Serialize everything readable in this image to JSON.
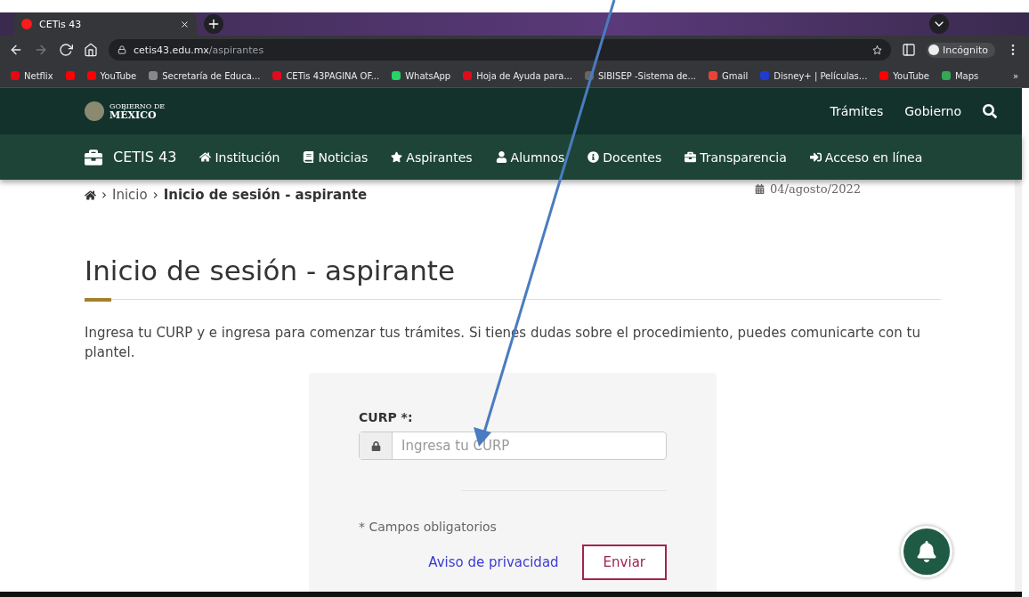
{
  "browser": {
    "tab": {
      "title": "CETis 43"
    },
    "url": {
      "host": "cetis43.edu.mx",
      "path": "/aspirantes"
    },
    "profile": "Incógnito",
    "bookmarks": [
      {
        "label": "Netflix",
        "color": "#e50914"
      },
      {
        "color": "#ff0000"
      },
      {
        "label": "YouTube",
        "color": "#ff0000"
      },
      {
        "label": "Secretaría de Educa...",
        "color": "#888888"
      },
      {
        "label": "CETis 43PAGINA OF...",
        "color": "#e00b1c"
      },
      {
        "label": "WhatsApp",
        "color": "#25d366"
      },
      {
        "label": "Hoja de Ayuda para...",
        "color": "#e00b1c"
      },
      {
        "label": "SIBISEP -Sistema de...",
        "color": "#666666"
      },
      {
        "label": "Gmail",
        "color": "#ea4335"
      },
      {
        "label": "Disney+ | Películas...",
        "color": "#1f3bd1"
      },
      {
        "label": "YouTube",
        "color": "#ff0000"
      },
      {
        "label": "Maps",
        "color": "#34a853"
      }
    ],
    "more": "»"
  },
  "gov_header": {
    "logo": "GOBIERNO DE",
    "logo_big": "MÉXICO",
    "links": [
      "Trámites",
      "Gobierno"
    ]
  },
  "nav": {
    "brand": "CETIS 43",
    "items": [
      {
        "label": "Institución"
      },
      {
        "label": "Noticias"
      },
      {
        "label": "Aspirantes"
      },
      {
        "label": "Alumnos"
      },
      {
        "label": "Docentes"
      },
      {
        "label": "Transparencia"
      },
      {
        "label": "Acceso en línea"
      }
    ]
  },
  "breadcrumb": {
    "separator": "›",
    "items": [
      "Inicio"
    ],
    "current": "Inicio de sesión - aspirante"
  },
  "date": "04/agosto/2022",
  "title": "Inicio de sesión - aspirante",
  "intro": "Ingresa tu CURP y e ingresa para comenzar tus trámites. Si tienes dudas sobre el procedimiento, puedes comunicarte con tu plantel.",
  "form": {
    "label": "CURP *:",
    "placeholder": "Ingresa tu CURP",
    "note": "* Campos obligatorios",
    "link": "Aviso de privacidad",
    "submit": "Enviar"
  }
}
